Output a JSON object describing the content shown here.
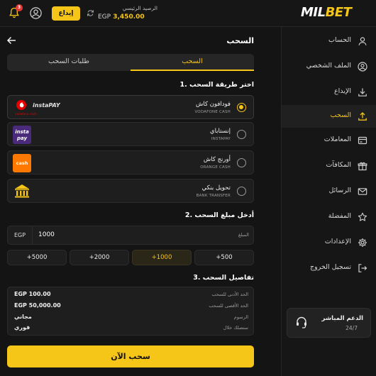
{
  "header": {
    "notification_count": "3",
    "deposit_label": "إيداع",
    "balance_label": "الرصيد الرئيسي",
    "balance_currency": "EGP",
    "balance_value": "3,450.00",
    "logo_mil": "MIL",
    "logo_bet": "BET",
    "accent_color": "#f5c518"
  },
  "sidebar": {
    "items": [
      {
        "label": "الحساب",
        "icon": "user-icon"
      },
      {
        "label": "الملف الشخصي",
        "icon": "profile-icon"
      },
      {
        "label": "الإيداع",
        "icon": "download-icon"
      },
      {
        "label": "السحب",
        "icon": "upload-icon",
        "active": true
      },
      {
        "label": "المعاملات",
        "icon": "transactions-icon"
      },
      {
        "label": "المكافآت",
        "icon": "gift-icon"
      },
      {
        "label": "الرسائل",
        "icon": "mail-icon"
      },
      {
        "label": "المفضلة",
        "icon": "star-icon"
      },
      {
        "label": "الإعدادات",
        "icon": "gear-icon"
      },
      {
        "label": "تسجيل الخروج",
        "icon": "logout-icon"
      }
    ],
    "support": {
      "title": "الدعم المباشر",
      "hours": "24/7",
      "icon": "headset-icon"
    }
  },
  "main": {
    "title": "السحب",
    "tabs": [
      {
        "label": "السحب",
        "active": true
      },
      {
        "label": "طلبات السحب",
        "active": false
      }
    ],
    "section1_title": "1. اختر طريقة السحب",
    "methods": [
      {
        "name": "فودافون كاش",
        "sub": "VODAFONE CASH",
        "selected": true,
        "logo": "vodafone-instapay-logo"
      },
      {
        "name": "إنستاباي",
        "sub": "INSTAPAY",
        "selected": false,
        "logo": "instapay-logo"
      },
      {
        "name": "أورنج كاش",
        "sub": "ORANGE CASH",
        "selected": false,
        "logo": "orange-cash-logo"
      },
      {
        "name": "تحويل بنكي",
        "sub": "BANK TRANSFER",
        "selected": false,
        "logo": "bank-icon"
      }
    ],
    "logo_text": {
      "instapay": "instaPAY",
      "vodafone": "vodafone cash",
      "insta_top": "insta",
      "insta_bottom": "pay",
      "orange": "cash"
    },
    "section2_title": "2. أدخل مبلغ السحب",
    "amount": {
      "currency": "EGP",
      "value": "1000",
      "label": "المبلغ"
    },
    "quick_amounts": [
      "+5000",
      "+2000",
      "+1000",
      "+500"
    ],
    "quick_selected": "+1000",
    "section3_title": "3. تفاصيل السحب",
    "details": [
      {
        "label": "الحد الأدنى للسحب",
        "value": "EGP 100.00"
      },
      {
        "label": "الحد الأقصى للسحب",
        "value": "EGP 50,000.00"
      },
      {
        "label": "الرسوم",
        "value": "مجاني"
      },
      {
        "label": "ستصلك خلال",
        "value": "فوري"
      }
    ],
    "submit_label": "سحب الآن"
  }
}
